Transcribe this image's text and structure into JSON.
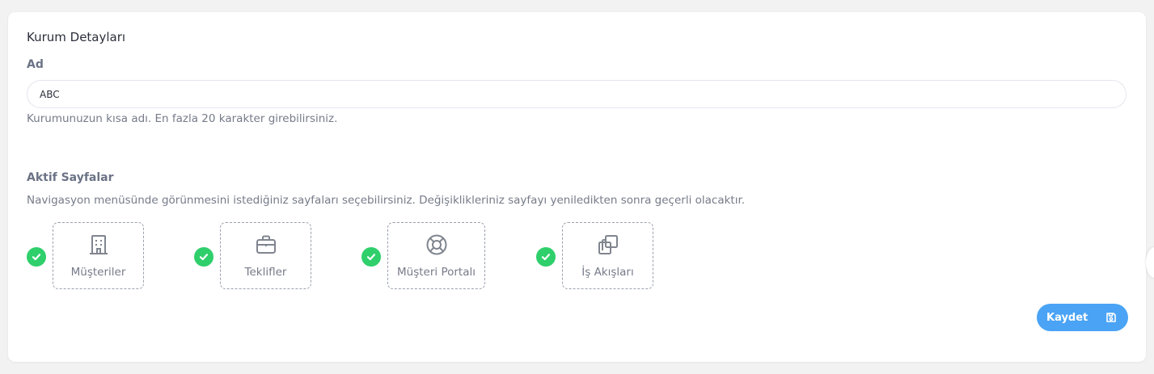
{
  "section": {
    "title": "Kurum Detayları"
  },
  "name_field": {
    "label": "Ad",
    "value": "ABC",
    "help": "Kurumunuzun kısa adı. En fazla 20 karakter girebilirsiniz."
  },
  "active_pages": {
    "label": "Aktif Sayfalar",
    "help": "Navigasyon menüsünde görünmesini istediğiniz sayfaları seçebilirsiniz. Değişiklikleriniz sayfayı yeniledikten sonra geçerli olacaktır.",
    "items": [
      {
        "label": "Müşteriler",
        "icon": "building-icon",
        "checked": true
      },
      {
        "label": "Teklifler",
        "icon": "briefcase-icon",
        "checked": true
      },
      {
        "label": "Müşteri Portalı",
        "icon": "lifebuoy-icon",
        "checked": true
      },
      {
        "label": "İş Akışları",
        "icon": "copy-stack-icon",
        "checked": true
      }
    ]
  },
  "actions": {
    "save_label": "Kaydet",
    "save_icon": "floppy-disk-icon"
  },
  "colors": {
    "accent": "#4aa3f5",
    "check": "#2fcf6b",
    "muted_text": "#757b88"
  }
}
